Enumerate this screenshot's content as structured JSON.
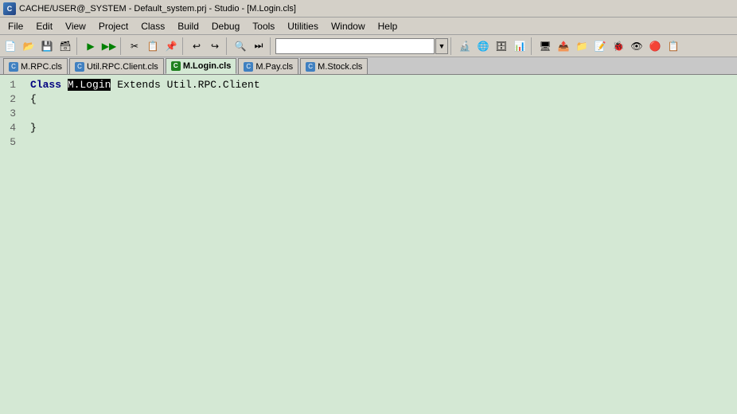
{
  "titleBar": {
    "icon": "C",
    "text": "CACHE/USER@_SYSTEM - Default_system.prj - Studio - [M.Login.cls]"
  },
  "menuBar": {
    "items": [
      "File",
      "Edit",
      "View",
      "Project",
      "Class",
      "Build",
      "Debug",
      "Tools",
      "Utilities",
      "Window",
      "Help"
    ]
  },
  "toolbar": {
    "dropdown_placeholder": ""
  },
  "tabs": [
    {
      "label": "M.RPC.cls",
      "active": false,
      "icon": "cls"
    },
    {
      "label": "Util.RPC.Client.cls",
      "active": false,
      "icon": "cls"
    },
    {
      "label": "M.Login.cls",
      "active": true,
      "icon": "cls"
    },
    {
      "label": "M.Pay.cls",
      "active": false,
      "icon": "cls"
    },
    {
      "label": "M.Stock.cls",
      "active": false,
      "icon": "cls"
    }
  ],
  "editor": {
    "lines": [
      {
        "num": "1",
        "tokens": [
          {
            "type": "keyword",
            "text": "Class "
          },
          {
            "type": "classname-highlight",
            "text": "M.Login"
          },
          {
            "type": "normal",
            "text": " Extends Util.RPC.Client"
          }
        ]
      },
      {
        "num": "2",
        "tokens": [
          {
            "type": "normal",
            "text": "{"
          }
        ]
      },
      {
        "num": "3",
        "tokens": []
      },
      {
        "num": "4",
        "tokens": [
          {
            "type": "normal",
            "text": "}"
          }
        ]
      },
      {
        "num": "5",
        "tokens": []
      }
    ]
  }
}
